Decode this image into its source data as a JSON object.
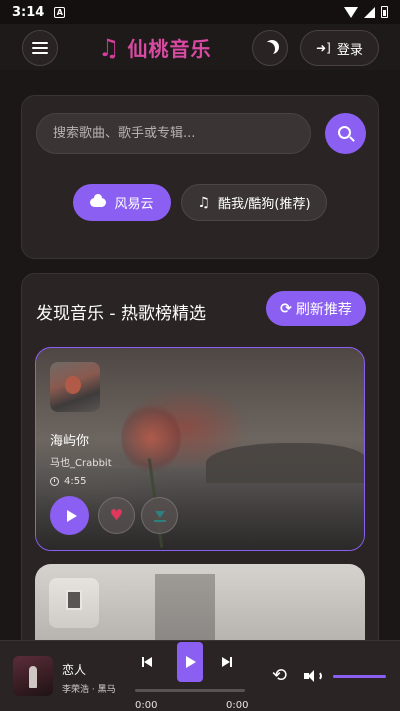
{
  "status_bar": {
    "time": "3:14",
    "notification_icon": "A"
  },
  "header": {
    "brand_icon": "music-note-icon",
    "brand_name": "仙桃音乐",
    "login_label": "登录"
  },
  "search": {
    "placeholder": "搜索歌曲、歌手或专辑...",
    "sources": [
      {
        "label": "风易云",
        "icon": "cloud-icon",
        "active": true
      },
      {
        "label": "酷我/酷狗(推荐)",
        "icon": "music-note-icon",
        "active": false
      }
    ]
  },
  "discover": {
    "title": "发现音乐 - 热歌榜精选",
    "refresh_label": "刷新推荐",
    "songs": [
      {
        "name": "海屿你",
        "artist": "马也_Crabbit",
        "duration": "4:55"
      },
      {
        "name": "",
        "artist": "",
        "duration": ""
      }
    ]
  },
  "player": {
    "title": "恋人",
    "artist": "李荣浩 · 黑马",
    "current_time": "0:00",
    "total_time": "0:00",
    "progress": 0,
    "volume": 1.0
  },
  "colors": {
    "accent": "#8b5ff2",
    "brand": "#d94aa3",
    "like": "#e0375f"
  }
}
